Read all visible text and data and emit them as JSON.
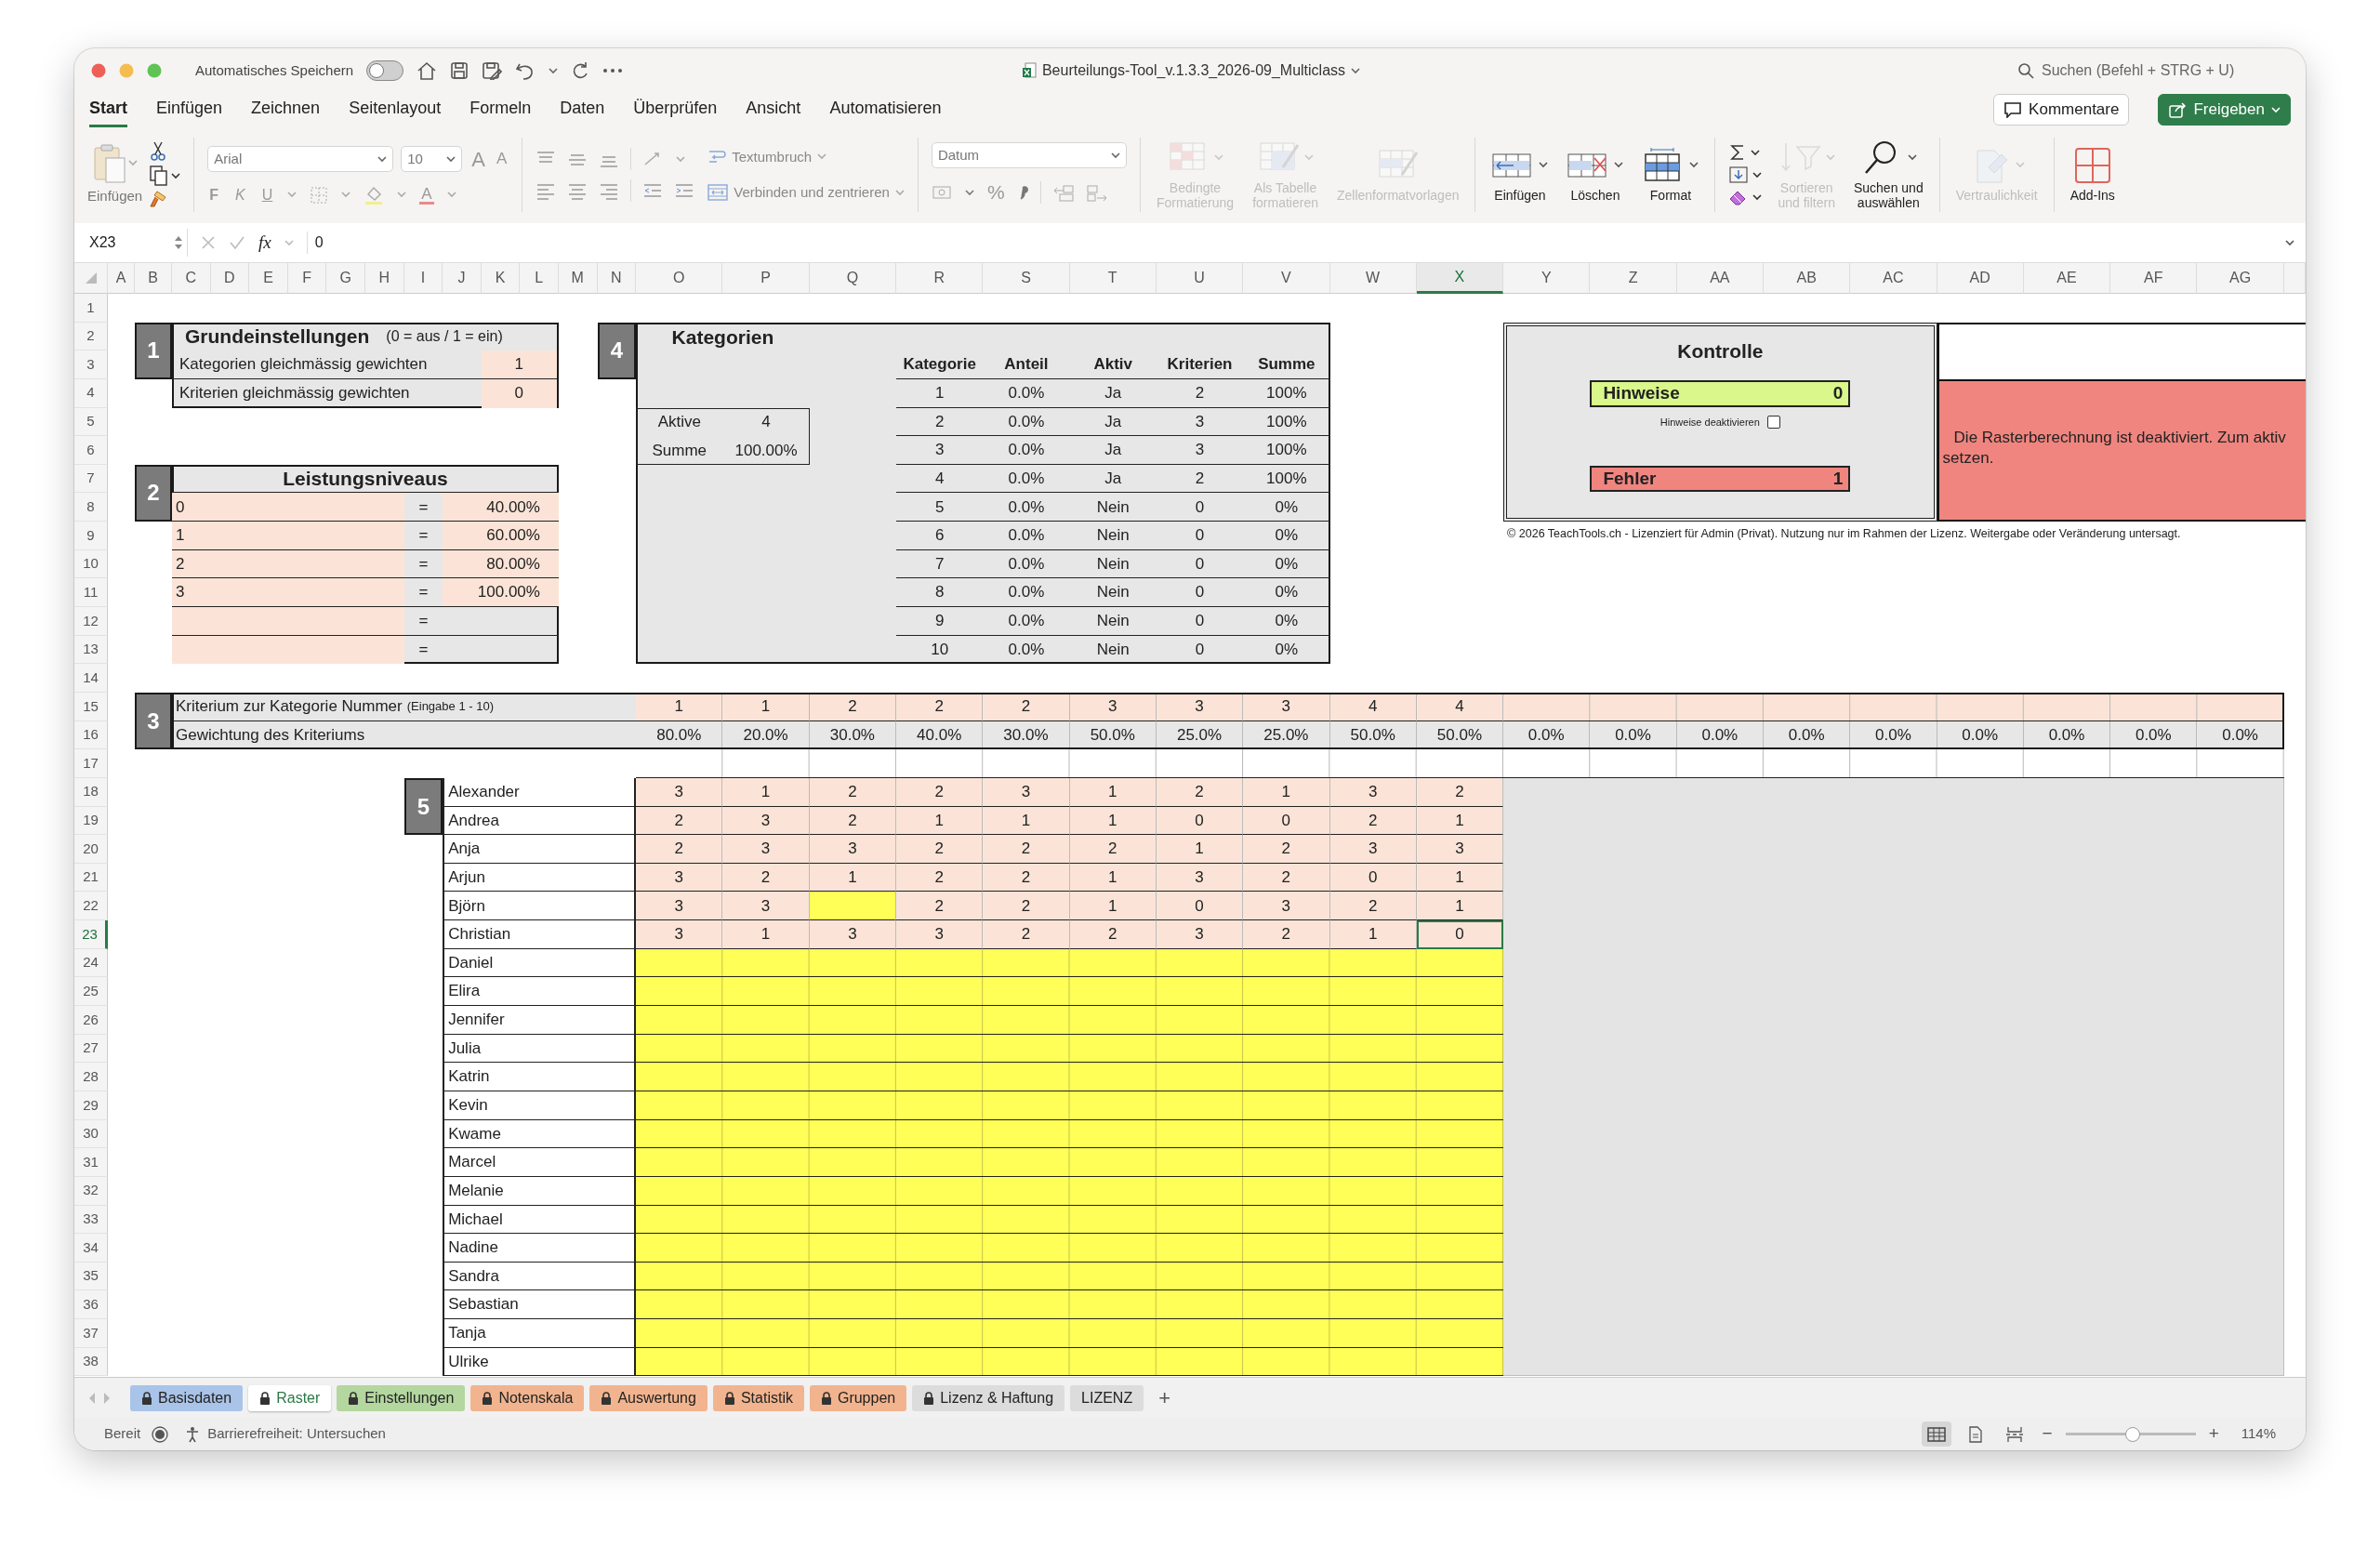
{
  "window": {
    "title": "Beurteilungs-Tool_v.1.3.3_2026-09_Multiclass",
    "autosave_label": "Automatisches Speichern",
    "autosave_on": false,
    "search": {
      "placeholder": "Suchen (Befehl + STRG + U)"
    }
  },
  "ribbon_tabs": [
    {
      "label": "Start",
      "selected": true
    },
    {
      "label": "Einfügen",
      "selected": false
    },
    {
      "label": "Zeichnen",
      "selected": false
    },
    {
      "label": "Seitenlayout",
      "selected": false
    },
    {
      "label": "Formeln",
      "selected": false
    },
    {
      "label": "Daten",
      "selected": false
    },
    {
      "label": "Überprüfen",
      "selected": false
    },
    {
      "label": "Ansicht",
      "selected": false
    },
    {
      "label": "Automatisieren",
      "selected": false
    }
  ],
  "header_buttons": {
    "comments": "Kommentare",
    "share": "Freigeben"
  },
  "ribbon": {
    "paste_label": "Einfügen",
    "font": {
      "name": "Arial",
      "size": "10",
      "grow": "A",
      "shrink": "A",
      "bold": "F",
      "italic": "K",
      "underline": "U",
      "color_letter": "A"
    },
    "wrap": "Textumbruch",
    "merge": "Verbinden und zentrieren",
    "number_format": "Datum",
    "percent": "%",
    "commands": [
      {
        "kind": "conditional",
        "lines": [
          "Bedingte",
          "Formatierung"
        ],
        "disabled": true
      },
      {
        "kind": "table",
        "lines": [
          "Als Tabelle",
          "formatieren"
        ],
        "disabled": true
      },
      {
        "kind": "styles",
        "lines": [
          "Zellenformatvorlagen"
        ],
        "disabled": true
      },
      {
        "kind": "insert",
        "lines": [
          "Einfügen"
        ],
        "disabled": false
      },
      {
        "kind": "delete",
        "lines": [
          "Löschen"
        ],
        "disabled": false
      },
      {
        "kind": "format",
        "lines": [
          "Format"
        ],
        "disabled": false
      },
      {
        "kind": "edit"
      },
      {
        "kind": "sort",
        "lines": [
          "Sortieren",
          "und filtern"
        ],
        "disabled": true
      },
      {
        "kind": "find",
        "lines": [
          "Suchen und",
          "auswählen"
        ],
        "disabled": false
      },
      {
        "kind": "sensitivity",
        "lines": [
          "Vertraulichkeit"
        ],
        "disabled": true
      },
      {
        "kind": "addins",
        "lines": [
          "Add-Ins"
        ],
        "disabled": false
      }
    ]
  },
  "formula_bar": {
    "cell": "X23",
    "function_label": "fx",
    "value": "0"
  },
  "columns": [
    {
      "label": "A",
      "selected": false
    },
    {
      "label": "B",
      "selected": false
    },
    {
      "label": "C",
      "selected": false
    },
    {
      "label": "D",
      "selected": false
    },
    {
      "label": "E",
      "selected": false
    },
    {
      "label": "F",
      "selected": false
    },
    {
      "label": "G",
      "selected": false
    },
    {
      "label": "H",
      "selected": false
    },
    {
      "label": "I",
      "selected": false
    },
    {
      "label": "J",
      "selected": false
    },
    {
      "label": "K",
      "selected": false
    },
    {
      "label": "L",
      "selected": false
    },
    {
      "label": "M",
      "selected": false
    },
    {
      "label": "N",
      "selected": false
    },
    {
      "label": "O",
      "selected": false
    },
    {
      "label": "P",
      "selected": false
    },
    {
      "label": "Q",
      "selected": false
    },
    {
      "label": "R",
      "selected": false
    },
    {
      "label": "S",
      "selected": false
    },
    {
      "label": "T",
      "selected": false
    },
    {
      "label": "U",
      "selected": false
    },
    {
      "label": "V",
      "selected": false
    },
    {
      "label": "W",
      "selected": false
    },
    {
      "label": "X",
      "selected": true
    },
    {
      "label": "Y",
      "selected": false
    },
    {
      "label": "Z",
      "selected": false
    },
    {
      "label": "AA",
      "selected": false
    },
    {
      "label": "AB",
      "selected": false
    },
    {
      "label": "AC",
      "selected": false
    },
    {
      "label": "AD",
      "selected": false
    },
    {
      "label": "AE",
      "selected": false
    },
    {
      "label": "AF",
      "selected": false
    },
    {
      "label": "AG",
      "selected": false
    }
  ],
  "rows": [
    {
      "label": "1",
      "selected": false
    },
    {
      "label": "2",
      "selected": false
    },
    {
      "label": "3",
      "selected": false
    },
    {
      "label": "4",
      "selected": false
    },
    {
      "label": "5",
      "selected": false
    },
    {
      "label": "6",
      "selected": false
    },
    {
      "label": "7",
      "selected": false
    },
    {
      "label": "8",
      "selected": false
    },
    {
      "label": "9",
      "selected": false
    },
    {
      "label": "10",
      "selected": false
    },
    {
      "label": "11",
      "selected": false
    },
    {
      "label": "12",
      "selected": false
    },
    {
      "label": "13",
      "selected": false
    },
    {
      "label": "14",
      "selected": false
    },
    {
      "label": "15",
      "selected": false
    },
    {
      "label": "16",
      "selected": false
    },
    {
      "label": "17",
      "selected": false
    },
    {
      "label": "18",
      "selected": false
    },
    {
      "label": "19",
      "selected": false
    },
    {
      "label": "20",
      "selected": false
    },
    {
      "label": "21",
      "selected": false
    },
    {
      "label": "22",
      "selected": false
    },
    {
      "label": "23",
      "selected": true
    },
    {
      "label": "24",
      "selected": false
    },
    {
      "label": "25",
      "selected": false
    },
    {
      "label": "26",
      "selected": false
    },
    {
      "label": "27",
      "selected": false
    },
    {
      "label": "28",
      "selected": false
    },
    {
      "label": "29",
      "selected": false
    },
    {
      "label": "30",
      "selected": false
    },
    {
      "label": "31",
      "selected": false
    },
    {
      "label": "32",
      "selected": false
    },
    {
      "label": "33",
      "selected": false
    },
    {
      "label": "34",
      "selected": false
    },
    {
      "label": "35",
      "selected": false
    },
    {
      "label": "36",
      "selected": false
    },
    {
      "label": "37",
      "selected": false
    },
    {
      "label": "38",
      "selected": false
    }
  ],
  "settings": {
    "number": "1",
    "title": "Grundeinstellungen",
    "note": "(0 = aus / 1 = ein)",
    "rows": [
      {
        "label": "Kategorien gleichmässig gewichten",
        "value": "1"
      },
      {
        "label": "Kriterien gleichmässig gewichten",
        "value": "0"
      }
    ]
  },
  "levels": {
    "number": "2",
    "title": "Leistungsniveaus",
    "rows": [
      {
        "level": "0",
        "equals": "=",
        "percent": "40.00%"
      },
      {
        "level": "1",
        "equals": "=",
        "percent": "60.00%"
      },
      {
        "level": "2",
        "equals": "=",
        "percent": "80.00%"
      },
      {
        "level": "3",
        "equals": "=",
        "percent": "100.00%"
      },
      {
        "equals": "="
      },
      {
        "equals": "="
      }
    ]
  },
  "categories": {
    "number": "4",
    "title": "Kategorien",
    "summary": [
      {
        "label": "Aktive",
        "value": "4"
      },
      {
        "label": "Summe",
        "value": "100.00%"
      }
    ],
    "columns": [
      "Kategorie",
      "Anteil",
      "Aktiv",
      "Kriterien",
      "Summe"
    ],
    "rows": [
      [
        "1",
        "0.0%",
        "Ja",
        "2",
        "100%"
      ],
      [
        "2",
        "0.0%",
        "Ja",
        "3",
        "100%"
      ],
      [
        "3",
        "0.0%",
        "Ja",
        "3",
        "100%"
      ],
      [
        "4",
        "0.0%",
        "Ja",
        "2",
        "100%"
      ],
      [
        "5",
        "0.0%",
        "Nein",
        "0",
        "0%"
      ],
      [
        "6",
        "0.0%",
        "Nein",
        "0",
        "0%"
      ],
      [
        "7",
        "0.0%",
        "Nein",
        "0",
        "0%"
      ],
      [
        "8",
        "0.0%",
        "Nein",
        "0",
        "0%"
      ],
      [
        "9",
        "0.0%",
        "Nein",
        "0",
        "0%"
      ],
      [
        "10",
        "0.0%",
        "Nein",
        "0",
        "0%"
      ]
    ]
  },
  "criteria": {
    "number": "3",
    "category_label": "Kriterium zur Kategorie Nummer",
    "category_hint": "(Eingabe 1 - 10)",
    "weight_label": "Gewichtung des Kriteriums",
    "categories": [
      "1",
      "1",
      "2",
      "2",
      "2",
      "3",
      "3",
      "3",
      "4",
      "4"
    ],
    "weights": [
      "80.0%",
      "20.0%",
      "30.0%",
      "40.0%",
      "30.0%",
      "50.0%",
      "25.0%",
      "25.0%",
      "50.0%",
      "50.0%",
      "0.0%",
      "0.0%",
      "0.0%",
      "0.0%",
      "0.0%",
      "0.0%",
      "0.0%",
      "0.0%",
      "0.0%"
    ]
  },
  "students": {
    "number": "5",
    "list": [
      {
        "name": "Alexander",
        "scores": [
          {
            "value": "3"
          },
          {
            "value": "1"
          },
          {
            "value": "2"
          },
          {
            "value": "2"
          },
          {
            "value": "3"
          },
          {
            "value": "1"
          },
          {
            "value": "2"
          },
          {
            "value": "1"
          },
          {
            "value": "3"
          },
          {
            "value": "2"
          }
        ]
      },
      {
        "name": "Andrea",
        "scores": [
          {
            "value": "2"
          },
          {
            "value": "3"
          },
          {
            "value": "2"
          },
          {
            "value": "1"
          },
          {
            "value": "1"
          },
          {
            "value": "1"
          },
          {
            "value": "0"
          },
          {
            "value": "0"
          },
          {
            "value": "2"
          },
          {
            "value": "1"
          }
        ]
      },
      {
        "name": "Anja",
        "scores": [
          {
            "value": "2"
          },
          {
            "value": "3"
          },
          {
            "value": "3"
          },
          {
            "value": "2"
          },
          {
            "value": "2"
          },
          {
            "value": "2"
          },
          {
            "value": "1"
          },
          {
            "value": "2"
          },
          {
            "value": "3"
          },
          {
            "value": "3"
          }
        ]
      },
      {
        "name": "Arjun",
        "scores": [
          {
            "value": "3"
          },
          {
            "value": "2"
          },
          {
            "value": "1"
          },
          {
            "value": "2"
          },
          {
            "value": "2"
          },
          {
            "value": "1"
          },
          {
            "value": "3"
          },
          {
            "value": "2"
          },
          {
            "value": "0"
          },
          {
            "value": "1"
          }
        ]
      },
      {
        "name": "Björn",
        "scores": [
          {
            "value": "3"
          },
          {
            "value": "3"
          },
          {
            "kind": "blank"
          },
          {
            "value": "2"
          },
          {
            "value": "2"
          },
          {
            "value": "1"
          },
          {
            "value": "0"
          },
          {
            "value": "3"
          },
          {
            "value": "2"
          },
          {
            "value": "1"
          }
        ]
      },
      {
        "name": "Christian",
        "scores": [
          {
            "value": "3"
          },
          {
            "value": "1"
          },
          {
            "value": "3"
          },
          {
            "value": "3"
          },
          {
            "value": "2"
          },
          {
            "value": "2"
          },
          {
            "value": "3"
          },
          {
            "value": "2"
          },
          {
            "value": "1"
          },
          {
            "value": "0"
          }
        ]
      },
      {
        "name": "Daniel"
      },
      {
        "name": "Elira"
      },
      {
        "name": "Jennifer"
      },
      {
        "name": "Julia"
      },
      {
        "name": "Katrin"
      },
      {
        "name": "Kevin"
      },
      {
        "name": "Kwame"
      },
      {
        "name": "Marcel"
      },
      {
        "name": "Melanie"
      },
      {
        "name": "Michael"
      },
      {
        "name": "Nadine"
      },
      {
        "name": "Sandra"
      },
      {
        "name": "Sebastian"
      },
      {
        "name": "Tanja"
      },
      {
        "name": "Ulrike"
      }
    ]
  },
  "control": {
    "title": "Kontrolle",
    "counters": [
      {
        "label": "Hinweise",
        "value": "0",
        "color": "#d9f78a"
      },
      {
        "label": "Fehler",
        "value": "1",
        "color": "#f0857f"
      }
    ],
    "checkbox_label": "Hinweise deaktivieren",
    "hints_disabled": false
  },
  "message": {
    "lines": [
      "Die Rasterberechnung ist deaktiviert. Zum aktiv",
      "setzen."
    ]
  },
  "copyright": "© 2026 TeachTools.ch - Lizenziert für Admin (Privat). Nutzung nur im Rahmen der Lizenz. Weitergabe oder Veränderung untersagt.",
  "sheet_tabs": [
    {
      "label": "Basisdaten",
      "color": "#a9c4e8",
      "locked": true,
      "selected": false
    },
    {
      "label": "Raster",
      "locked": true,
      "selected": true
    },
    {
      "label": "Einstellungen",
      "color": "#b3d79f",
      "locked": true,
      "selected": false
    },
    {
      "label": "Notenskala",
      "color": "#f2b48e",
      "locked": true,
      "selected": false
    },
    {
      "label": "Auswertung",
      "color": "#f2b48e",
      "locked": true,
      "selected": false
    },
    {
      "label": "Statistik",
      "color": "#f2b48e",
      "locked": true,
      "selected": false
    },
    {
      "label": "Gruppen",
      "color": "#f2b48e",
      "locked": true,
      "selected": false
    },
    {
      "label": "Lizenz & Haftung",
      "color": "#dcdcdc",
      "locked": true,
      "selected": false
    },
    {
      "label": "LIZENZ",
      "color": "#dcdcdc",
      "locked": false,
      "selected": false
    }
  ],
  "add_sheet": "+",
  "status_bar": {
    "ready": "Bereit",
    "accessibility": "Barrierefreiheit: Untersuchen",
    "views": [
      {
        "kind": "normal",
        "selected": true
      },
      {
        "kind": "layout",
        "selected": false
      },
      {
        "kind": "break",
        "selected": false
      }
    ],
    "zoom_out": "−",
    "zoom_slider": {
      "level": 0.52
    },
    "zoom_in": "+",
    "zoom": "114%"
  }
}
